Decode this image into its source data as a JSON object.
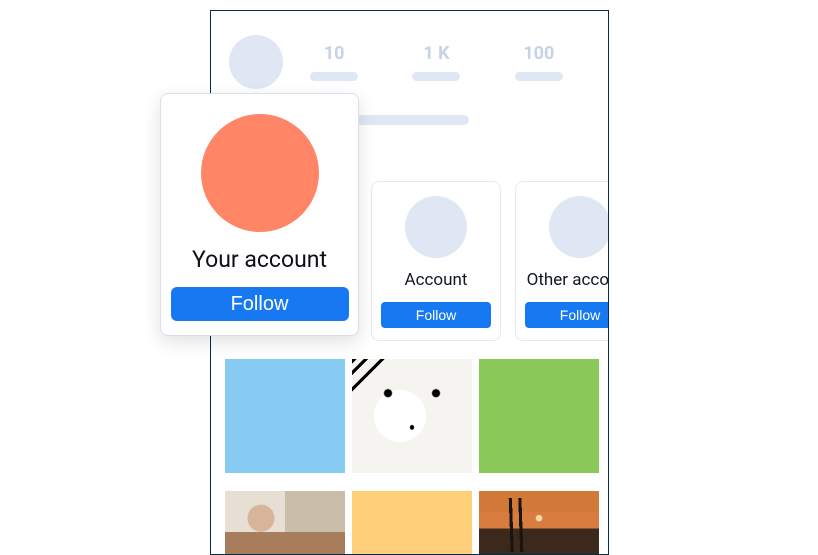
{
  "profile": {
    "stats": [
      {
        "value": "10"
      },
      {
        "value": "1 K"
      },
      {
        "value": "100"
      }
    ]
  },
  "suggestions": [
    {
      "name": "Account",
      "follow_label": "Follow"
    },
    {
      "name": "Other account",
      "follow_label": "Follow"
    }
  ],
  "popover": {
    "title": "Your account",
    "follow_label": "Follow"
  }
}
